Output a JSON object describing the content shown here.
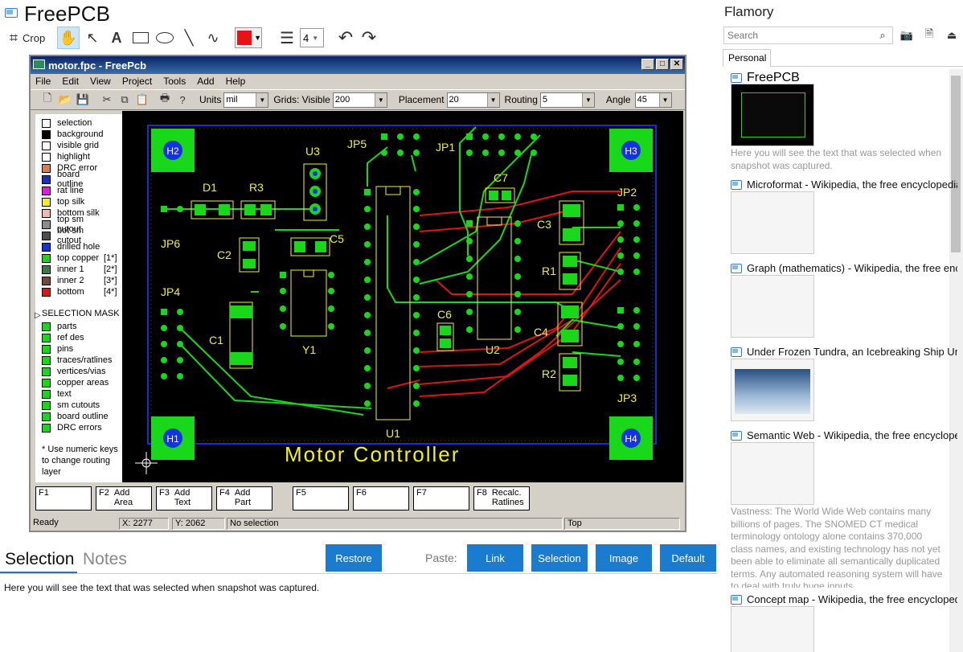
{
  "app": {
    "title": "FreePCB"
  },
  "toolbar": {
    "crop_label": "Crop",
    "text_tool": "A",
    "line_width": "4",
    "color": "#e81414"
  },
  "pcb_window": {
    "title": "motor.fpc - FreePcb",
    "menu": [
      "File",
      "Edit",
      "View",
      "Project",
      "Tools",
      "Add",
      "Help"
    ],
    "units_label": "Units",
    "units_value": "mil",
    "grids_label": "Grids: Visible",
    "grids_value": "200",
    "placement_label": "Placement",
    "placement_value": "20",
    "routing_label": "Routing",
    "routing_value": "5",
    "angle_label": "Angle",
    "angle_value": "45",
    "layers": [
      {
        "label": "selection",
        "color": "#ffffff"
      },
      {
        "label": "background",
        "color": "#000000"
      },
      {
        "label": "visible grid",
        "color": "#ffffff"
      },
      {
        "label": "highlight",
        "color": "#ffffff"
      },
      {
        "label": "DRC error",
        "color": "#e07b4e"
      },
      {
        "label": "board outline",
        "color": "#1c2bd0"
      },
      {
        "label": "rat line",
        "color": "#e619e6"
      },
      {
        "label": "top silk",
        "color": "#f2f21a"
      },
      {
        "label": "bottom silk",
        "color": "#f2b8b0"
      },
      {
        "label": "top sm cutout",
        "color": "#8c8c8c"
      },
      {
        "label": "bot sm cutout",
        "color": "#4d4d4d"
      },
      {
        "label": "drilled hole",
        "color": "#1432e0"
      },
      {
        "label": "top copper",
        "color": "#19d719",
        "suffix": "[1*]"
      },
      {
        "label": "inner 1",
        "color": "#3c7a4b",
        "suffix": "[2*]"
      },
      {
        "label": "inner 2",
        "color": "#7a4636",
        "suffix": "[3*]"
      },
      {
        "label": "bottom",
        "color": "#e01414",
        "suffix": "[4*]"
      }
    ],
    "mask_title": "SELECTION MASK",
    "mask_items": [
      "parts",
      "ref des",
      "pins",
      "traces/ratlines",
      "vertices/vias",
      "copper areas",
      "text",
      "sm cutouts",
      "board outline",
      "DRC errors"
    ],
    "mask_color": "#19d719",
    "note": "* Use numeric keys to change routing layer",
    "board": {
      "title": "Motor Controller",
      "ref_labels": [
        "H2",
        "H3",
        "H1",
        "H4",
        "JP5",
        "JP1",
        "U3",
        "D1",
        "R3",
        "C7",
        "JP2",
        "C3",
        "JP6",
        "C5",
        "C2",
        "R1",
        "JP4",
        "C6",
        "C4",
        "C1",
        "Y1",
        "U2",
        "R2",
        "JP3",
        "U1"
      ]
    },
    "fkeys": [
      {
        "key": "F1",
        "label": ""
      },
      {
        "key": "F2",
        "label": "Add Area"
      },
      {
        "key": "F3",
        "label": "Add Text"
      },
      {
        "key": "F4",
        "label": "Add Part"
      },
      {
        "key": "F5",
        "label": ""
      },
      {
        "key": "F6",
        "label": ""
      },
      {
        "key": "F7",
        "label": ""
      },
      {
        "key": "F8",
        "label": "Recalc. Ratlines"
      }
    ],
    "status": {
      "ready": "Ready",
      "x": "X: 2277",
      "y": "Y: 2062",
      "selection": "No selection",
      "layer": "Top"
    }
  },
  "bottom": {
    "tab_selection": "Selection",
    "tab_notes": "Notes",
    "restore": "Restore",
    "paste_label": "Paste:",
    "link": "Link",
    "selection": "Selection",
    "image": "Image",
    "default": "Default",
    "text": "Here you will see the text that was selected when snapshot was captured.",
    "accent": "#1a7ccf"
  },
  "sidebar": {
    "title": "Flamory",
    "search_placeholder": "Search",
    "tab": "Personal",
    "items": [
      {
        "title": "FreePCB",
        "desc": "Here you will see the text that was selected when snapshot was captured."
      },
      {
        "title": "Microformat - Wikipedia, the free encyclopedia"
      },
      {
        "title": "Graph (mathematics) - Wikipedia, the free ency"
      },
      {
        "title": "Under Frozen Tundra, an Icebreaking Ship Unco"
      },
      {
        "title": "Semantic Web - Wikipedia, the free encycloped",
        "desc": "Vastness: The World Wide Web contains many billions of pages. The SNOMED CT medical terminology ontology alone contains 370,000 class names, and existing technology has not yet been able to eliminate all semantically duplicated terms. Any automated reasoning system will have to deal with truly huge inputs."
      },
      {
        "title": "Concept map - Wikipedia, the free encyclopedia"
      }
    ]
  }
}
